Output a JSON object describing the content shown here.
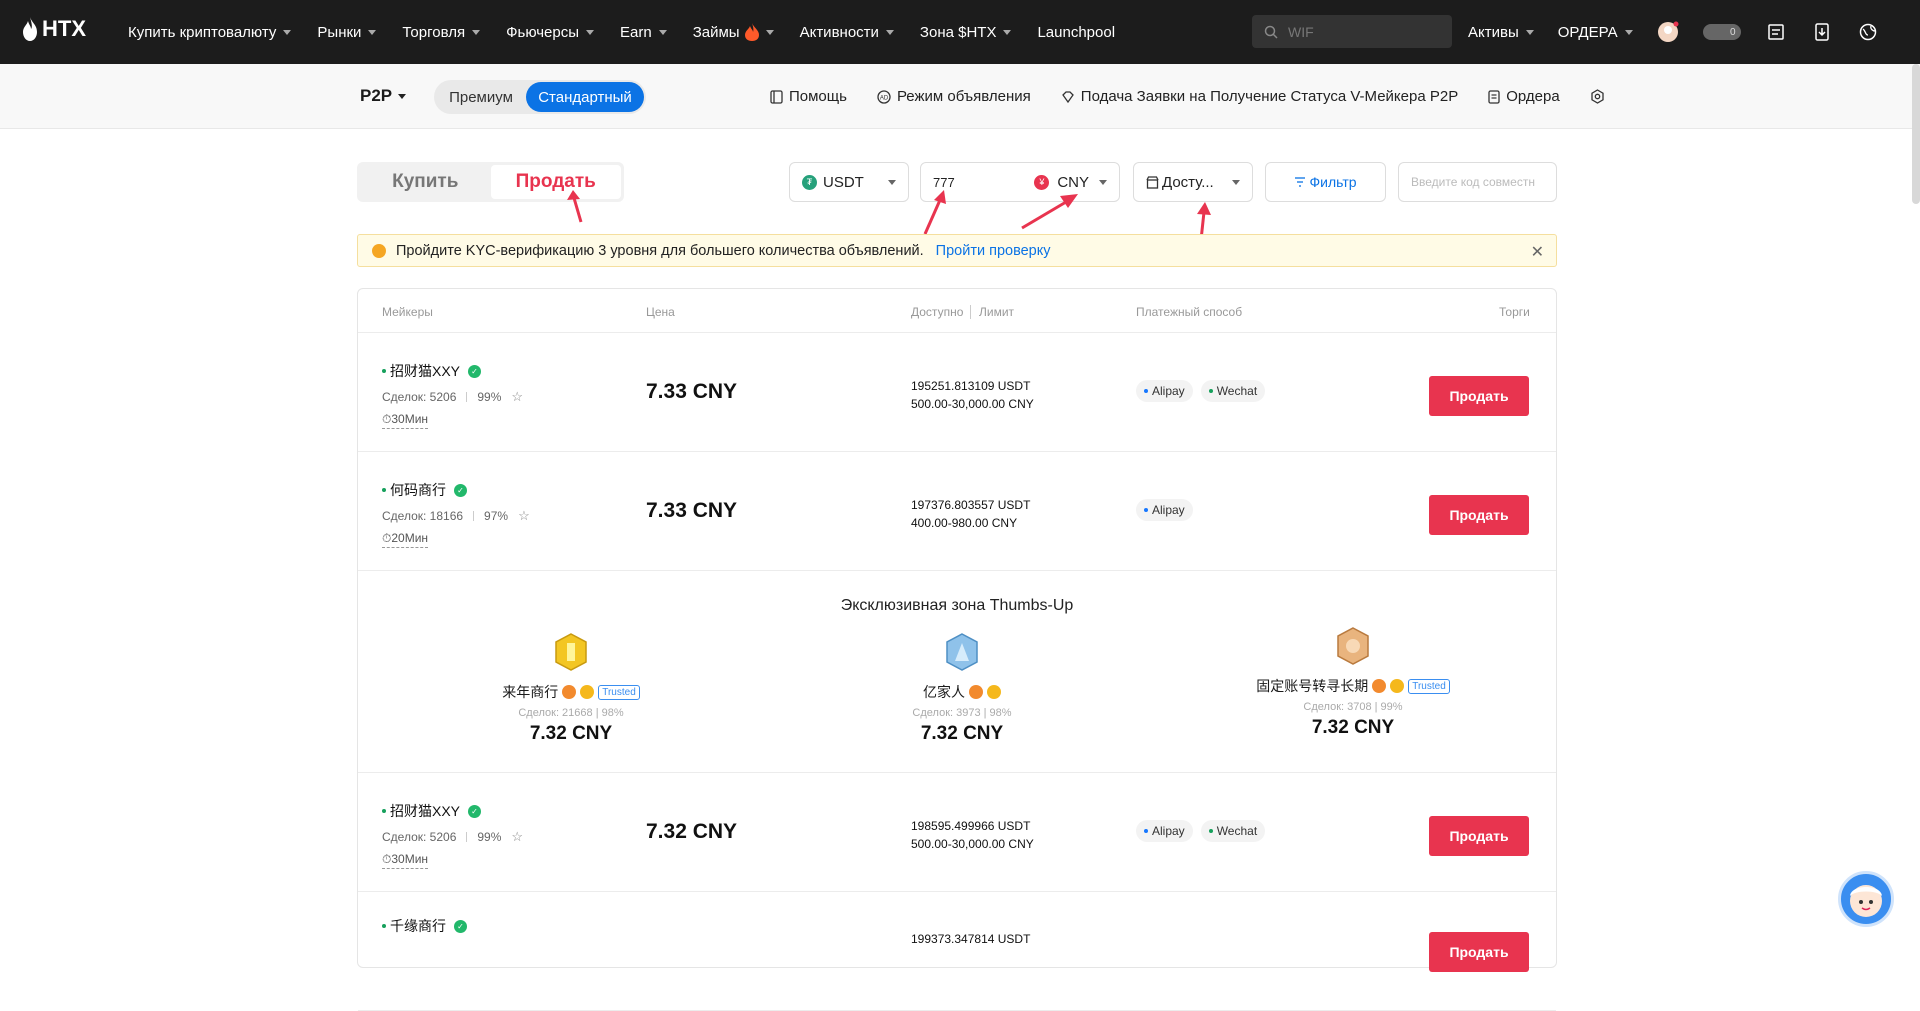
{
  "nav": {
    "logo_text": "HTX",
    "items": [
      {
        "label": "Купить криптовалюту",
        "caret": true
      },
      {
        "label": "Рынки",
        "caret": true
      },
      {
        "label": "Торговля",
        "caret": true
      },
      {
        "label": "Фьючерсы",
        "caret": true
      },
      {
        "label": "Earn",
        "caret": true
      },
      {
        "label": "Займы",
        "caret": true
      },
      {
        "label": "Активности",
        "caret": true
      },
      {
        "label": "Зона $HTX",
        "caret": true
      },
      {
        "label": "Launchpool",
        "caret": false
      }
    ],
    "search_placeholder": "WIF",
    "assets_label": "Активы",
    "orders_label": "ОРДЕРА",
    "toggle_count": "0"
  },
  "subbar": {
    "p2p_label": "P2P",
    "mode_premium": "Премиум",
    "mode_standard": "Стандартный",
    "help": "Помощь",
    "ad_mode": "Режим объявления",
    "vmaker": "Подача Заявки на Получение Статуса V-Мейкера P2P",
    "orders": "Ордера"
  },
  "trade": {
    "buy_label": "Купить",
    "sell_label": "Продать",
    "coin": "USDT",
    "amount": "777",
    "fiat": "CNY",
    "available": "Досту...",
    "filter": "Фильтр",
    "invite_placeholder": "Введите код совместн"
  },
  "kyc": {
    "text": "Пройдите KYC-верификацию 3 уровня для большего количества объявлений.",
    "link": "Пройти проверку"
  },
  "table_headers": {
    "makers": "Мейкеры",
    "price": "Цена",
    "available": "Доступно",
    "limit": "Лимит",
    "payment": "Платежный способ",
    "trades": "Торги"
  },
  "rows": [
    {
      "name": "招财猫XXY",
      "deals": "Сделок: 5206",
      "rate": "99%",
      "time": "30Мин",
      "price": "7.33 CNY",
      "available": "195251.813109 USDT",
      "limit": "500.00-30,000.00 CNY",
      "pay1": "Alipay",
      "pay2": "Wechat",
      "action": "Продать"
    },
    {
      "name": "何码商行",
      "deals": "Сделок: 18166",
      "rate": "97%",
      "time": "20Мин",
      "price": "7.33 CNY",
      "available": "197376.803557 USDT",
      "limit": "400.00-980.00 CNY",
      "pay1": "Alipay",
      "pay2": "",
      "action": "Продать"
    },
    {
      "name": "招财猫XXY",
      "deals": "Сделок: 5206",
      "rate": "99%",
      "time": "30Мин",
      "price": "7.32 CNY",
      "available": "198595.499966 USDT",
      "limit": "500.00-30,000.00 CNY",
      "pay1": "Alipay",
      "pay2": "Wechat",
      "action": "Продать"
    },
    {
      "name": "千缘商行",
      "available": "199373.347814 USDT",
      "action": "Продать"
    }
  ],
  "thumbs": {
    "title": "Эксклюзивная зона Thumbs-Up",
    "cards": [
      {
        "name": "来年商行",
        "trusted": "Trusted",
        "stats": "Сделок: 21668 | 98%",
        "price": "7.32 CNY"
      },
      {
        "name": "亿家人",
        "stats": "Сделок: 3973 | 98%",
        "price": "7.32 CNY"
      },
      {
        "name": "固定账号转寻长期",
        "trusted": "Trusted",
        "stats": "Сделок: 3708 | 99%",
        "price": "7.32 CNY"
      }
    ]
  },
  "colors": {
    "accent": "#0b73e5",
    "sell": "#e8344f",
    "alipay": "#1677ff",
    "wechat": "#16a05c"
  }
}
